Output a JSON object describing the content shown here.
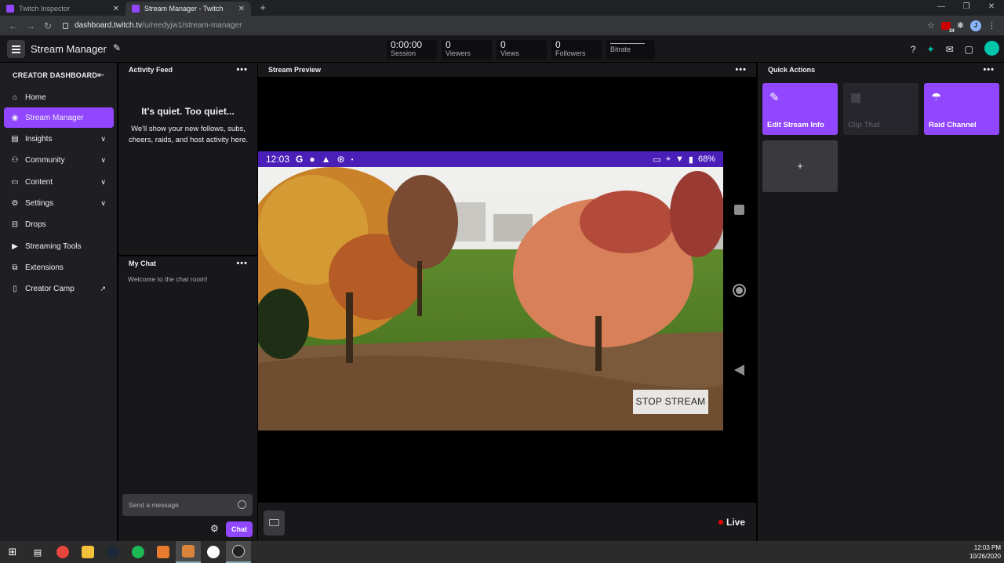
{
  "browser": {
    "tabs": [
      {
        "title": "Twitch Inspector",
        "active": false
      },
      {
        "title": "Stream Manager - Twitch",
        "active": true
      }
    ],
    "url_host": "dashboard.twitch.tv",
    "url_path": "/u/reedyjw1/stream-manager",
    "profile_initial": "J",
    "ext_badge": "24"
  },
  "header": {
    "title": "Stream Manager",
    "stats": [
      {
        "value": "0:00:00",
        "label": "Session"
      },
      {
        "value": "0",
        "label": "Viewers"
      },
      {
        "value": "0",
        "label": "Views"
      },
      {
        "value": "0",
        "label": "Followers"
      },
      {
        "value": "",
        "label": "Bitrate"
      }
    ]
  },
  "sidebar": {
    "heading": "CREATOR DASHBOARD",
    "items": [
      {
        "label": "Home",
        "icon": "home-icon"
      },
      {
        "label": "Stream Manager",
        "icon": "broadcast-icon",
        "active": true
      },
      {
        "label": "Insights",
        "icon": "insights-icon",
        "expandable": true
      },
      {
        "label": "Community",
        "icon": "community-icon",
        "expandable": true
      },
      {
        "label": "Content",
        "icon": "content-icon",
        "expandable": true
      },
      {
        "label": "Settings",
        "icon": "gear-icon",
        "expandable": true
      },
      {
        "label": "Drops",
        "icon": "drops-icon"
      },
      {
        "label": "Streaming Tools",
        "icon": "camera-icon"
      },
      {
        "label": "Extensions",
        "icon": "puzzle-icon"
      },
      {
        "label": "Creator Camp",
        "icon": "book-icon",
        "external": true
      }
    ]
  },
  "activity_feed": {
    "title": "Activity Feed",
    "empty_title": "It's quiet. Too quiet...",
    "empty_body": "We'll show your new follows, subs, cheers, raids, and host activity here."
  },
  "chat": {
    "title": "My Chat",
    "welcome": "Welcome to the chat room!",
    "placeholder": "Send a message",
    "send_label": "Chat"
  },
  "preview": {
    "title": "Stream Preview",
    "phone_time": "12:03",
    "phone_battery": "68%",
    "stop_label": "STOP STREAM",
    "live_label": "Live"
  },
  "quick_actions": {
    "title": "Quick Actions",
    "tiles": [
      {
        "label": "Edit Stream Info",
        "enabled": true,
        "icon": "pencil-icon"
      },
      {
        "label": "Clip That",
        "enabled": false,
        "icon": "clapper-icon"
      },
      {
        "label": "Raid Channel",
        "enabled": true,
        "icon": "parachute-icon"
      }
    ],
    "add_label": "+"
  },
  "taskbar": {
    "time": "12:03 PM",
    "date": "10/26/2020"
  },
  "colors": {
    "accent": "#9147ff",
    "live": "#eb0400"
  }
}
